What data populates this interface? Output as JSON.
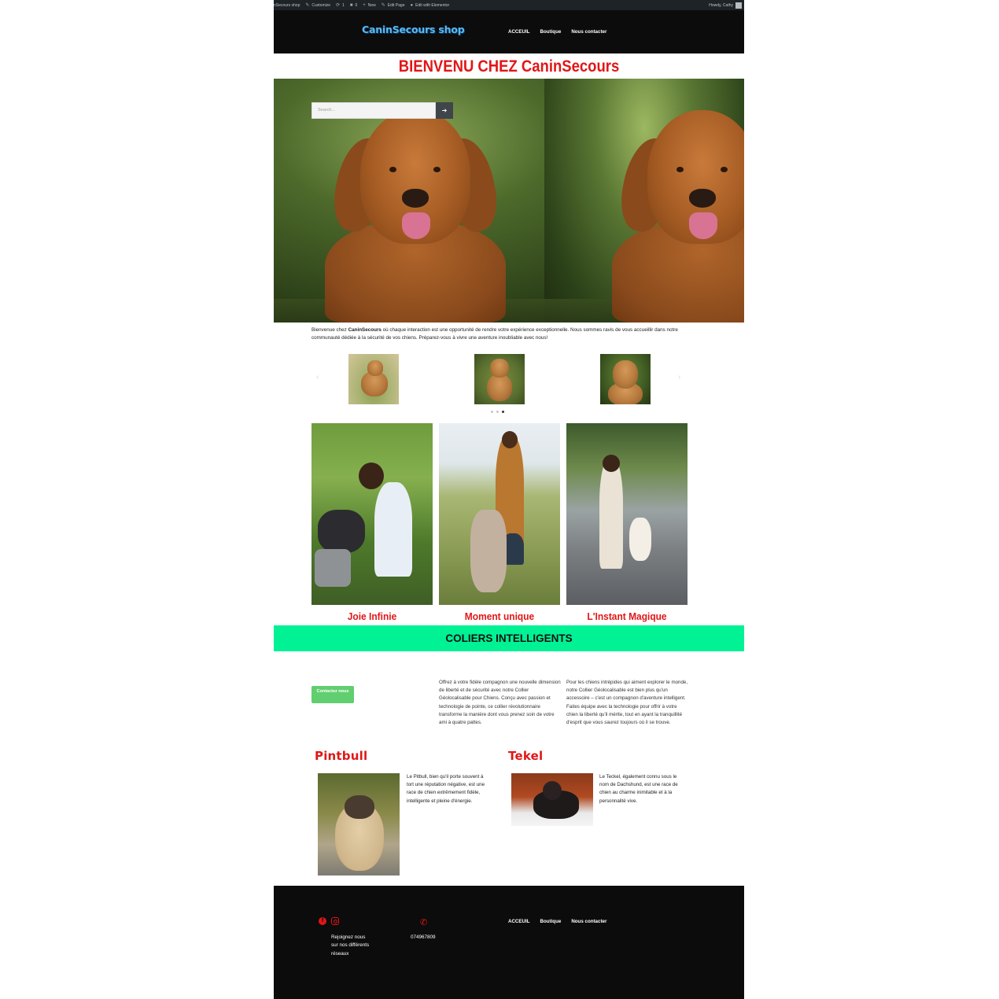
{
  "admin_bar": {
    "site": "nSecours shop",
    "customize": "Customize",
    "updates": "1",
    "comments": "0",
    "new": "New",
    "edit_page": "Edit Page",
    "edit_elementor": "Edit with Elementor",
    "howdy": "Howdy, Cathy"
  },
  "header": {
    "logo": "CaninSecours shop",
    "nav": [
      "ACCEUIL",
      "Boutique",
      "Nous contacter"
    ]
  },
  "hero": {
    "title": "BIENVENU CHEZ CaninSecours",
    "search_placeholder": "Search...",
    "search_button_icon": "arrow-right-icon"
  },
  "intro": {
    "before": "Bienvenue chez ",
    "brand": "CaninSecours",
    "after": " où chaque interaction est une opportunité de rendre votre expérience exceptionnelle. Nous sommes ravis de vous accueillir dans notre communauté dédiée à la sécurité de vos chiens. Préparez-vous à vivre une aventure inoubliable avec nous!"
  },
  "carousel": {
    "prev_icon": "chevron-left-icon",
    "next_icon": "chevron-right-icon",
    "slide_count": 3,
    "active_index": 2
  },
  "gallery": {
    "captions": [
      "Joie Infinie",
      "Moment unique",
      "L'Instant Magique"
    ]
  },
  "band": {
    "title": "COLIERS INTELLIGENTS"
  },
  "features": {
    "button": "Contactez nous",
    "col_a": "Offrez à votre fidèle compagnon une nouvelle dimension de liberté et de sécurité avec notre Collier Géolocalisable pour Chiens. Conçu avec passion et technologie de pointe, ce collier révolutionnaire transforme la manière dont vous prenez soin de votre ami à quatre pattes.",
    "col_b": "Pour les chiens intrépides qui aiment explorer le monde, notre Collier Géolocalisable est bien plus qu'un accessoire – c'est un compagnon d'aventure intelligent. Faites équipe avec la technologie pour offrir à votre chien la liberté qu'il mérite, tout en ayant la tranquillité d'esprit que vous saurez toujours où il se trouve."
  },
  "breeds": [
    {
      "title": "Pintbull",
      "text": "Le Pitbull, bien qu'il porte souvent à tort une réputation négative, est une race de chien extrêmement fidèle, intelligente et pleine d'énergie."
    },
    {
      "title": "Tekel",
      "text": "Le Teckel, également connu sous le nom de Dachshund, est une race de chien au charme inimitable et à la personnalité vive."
    }
  ],
  "footer": {
    "social_icons": [
      "facebook-icon",
      "instagram-icon"
    ],
    "join": "Rejoignez nous sur nos différents réseaux",
    "phone": "074967809",
    "nav": [
      "ACCEUIL",
      "Boutique",
      "Nous contacter"
    ]
  },
  "colors": {
    "accent_red": "#e11616",
    "band_green": "#00f294",
    "button_green": "#61ce70",
    "header_black": "#0c0c0c",
    "logo_blue": "#5ab9ee"
  }
}
